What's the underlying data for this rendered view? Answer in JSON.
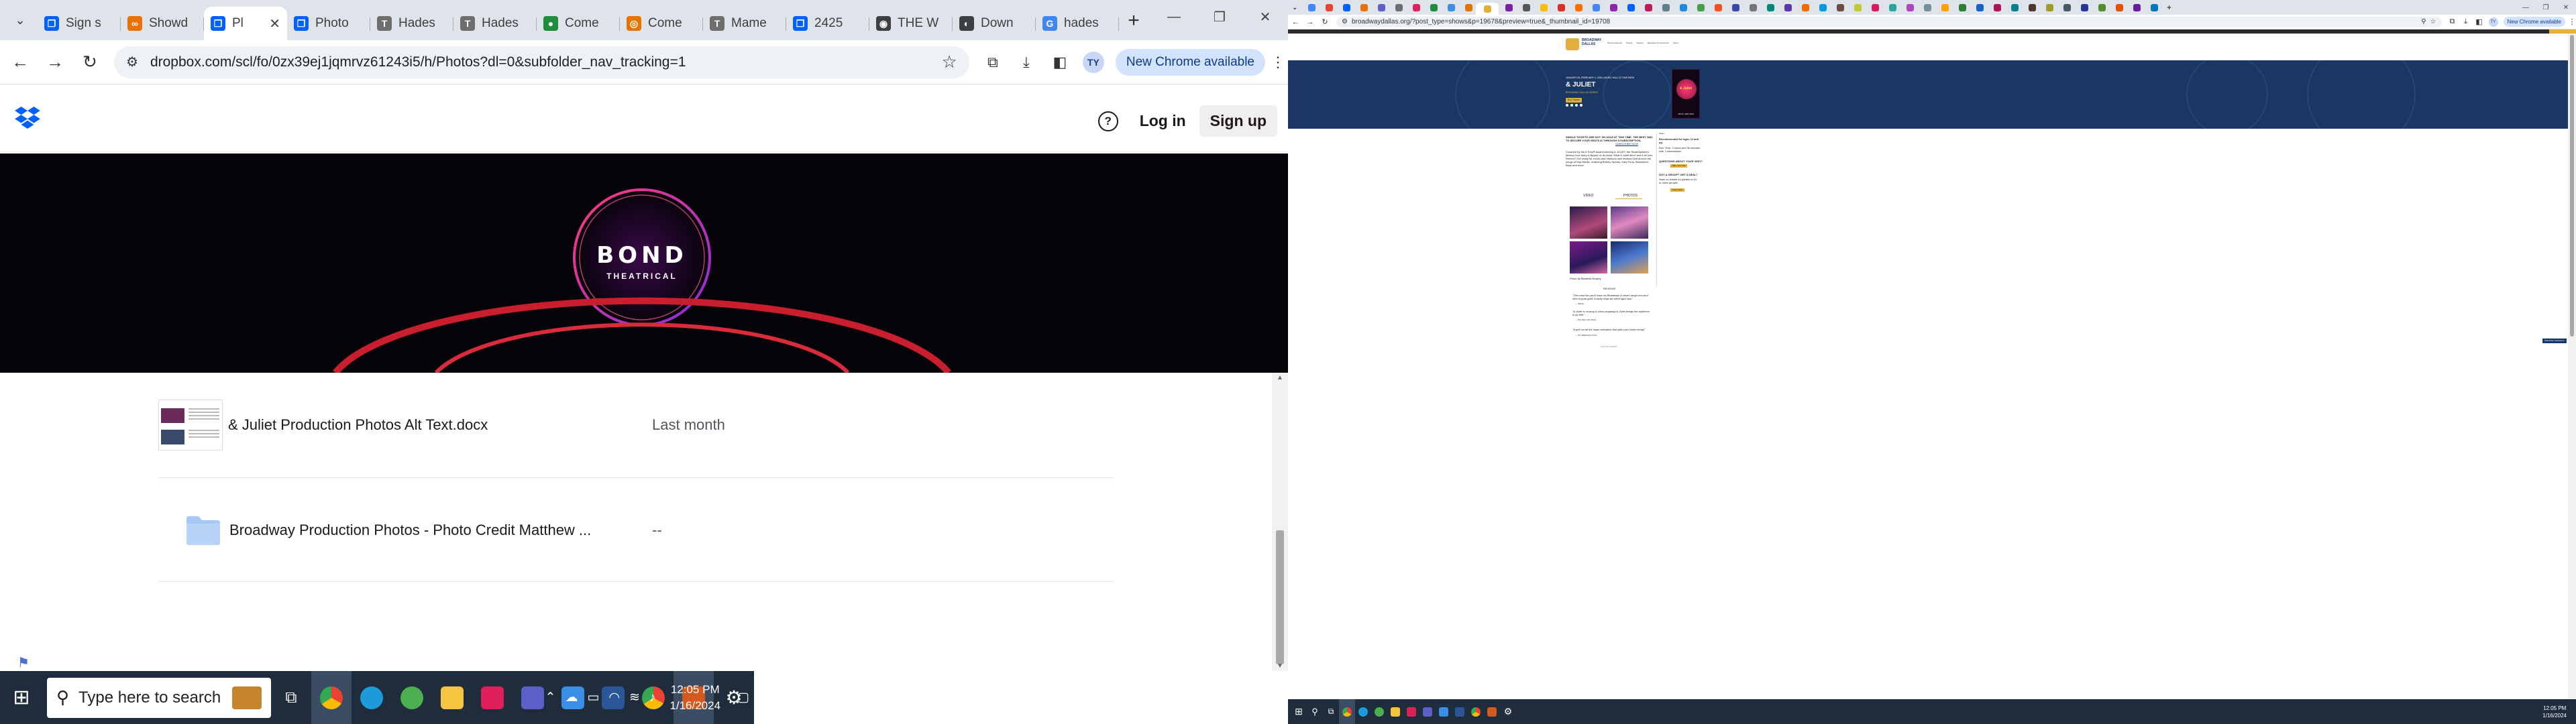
{
  "left_window": {
    "tabs": [
      {
        "title": "Sign s",
        "color": "#0061fe",
        "glyph": "❐"
      },
      {
        "title": "Showd",
        "color": "#e8710a",
        "glyph": "∞"
      },
      {
        "title": "Pl",
        "color": "#0061fe",
        "glyph": "❐",
        "active": true
      },
      {
        "title": "Photo",
        "color": "#0061fe",
        "glyph": "❐"
      },
      {
        "title": "Hades",
        "color": "#6e6e6e",
        "glyph": "T"
      },
      {
        "title": "Hades",
        "color": "#6e6e6e",
        "glyph": "T"
      },
      {
        "title": "Come",
        "color": "#1e8e3e",
        "glyph": "●"
      },
      {
        "title": "Come",
        "color": "#e37400",
        "glyph": "◎"
      },
      {
        "title": "Mame",
        "color": "#6e6e6e",
        "glyph": "T"
      },
      {
        "title": "2425",
        "color": "#0061fe",
        "glyph": "❐"
      },
      {
        "title": "THE W",
        "color": "#3c4043",
        "glyph": "◉"
      },
      {
        "title": "Down",
        "color": "#3c4043",
        "glyph": "◐"
      },
      {
        "title": "hades",
        "color": "#4285f4",
        "glyph": "G"
      }
    ],
    "url": "dropbox.com/scl/fo/0zx39ej1jqmrvz61243i5/h/Photos?dl=0&subfolder_nav_tracking=1",
    "profile_initials": "TY",
    "new_chrome_label": "New Chrome available",
    "header": {
      "login_label": "Log in",
      "signup_label": "Sign up",
      "help_glyph": "?"
    },
    "hero": {
      "brand": "BOND",
      "tagline": "THEATRICAL"
    },
    "files": [
      {
        "name": "& Juliet Production Photos Alt Text.docx",
        "modified": "Last month"
      },
      {
        "name": "Broadway Production Photos - Photo Credit Matthew ...",
        "modified": "--"
      }
    ],
    "colors": {
      "dropbox_blue": "#0061fe",
      "folder_blue": "#a8c8f5"
    }
  },
  "left_taskbar": {
    "search_placeholder": "Type here to search",
    "time": "12:05 PM",
    "date": "1/16/2024"
  },
  "right_window": {
    "url": "broadwaydallas.org/?post_type=shows&p=19678&preview=true&_thumbnail_id=19708",
    "profile_initials": "TY",
    "new_chrome_label": "New Chrome available",
    "nav": {
      "logo_top": "BROADWAY",
      "logo_bottom": "DALLAS",
      "links": [
        "Shows & Events",
        "Tickets",
        "Support",
        "Education & Community",
        "About"
      ]
    },
    "hero": {
      "dates": "JANUARY 30–FEBRUARY 4, 2024 | MUSIC HALL AT FAIR PARK",
      "title": "& JULIET",
      "subtitle": "BROADWAY DALLAS SERIES",
      "buy_label": "Buy Tickets",
      "poster_title": "& Juliet",
      "poster_footer": "JAN 30 - FEB 4 2024"
    },
    "intro": "SINGLE TICKETS ARE NOT ON SALE AT THIS TIME. THE BEST WAY TO SECURE YOUR SEATS IS THROUGH A SUBSCRIPTION.",
    "subscribe_link": "SUBSCRIBE NOW",
    "body": "Crowned by the 8 Tony® Award-winning & JULIET, the Shakespeare's famous love story is flipped on its head. What if Juliet didn't end it all over Romeo? Get ready for a bold and hilarious new musical built around the songs of Max Martin, featuring Britney Spears, Katy Perry, Backstreet Boys and more.",
    "media_tabs": [
      "VIDEO",
      "PHOTOS"
    ],
    "photo_credit": "Photo by Matthew Murphy",
    "reviews_heading": "REVIEWS",
    "reviews": [
      {
        "quote": "\"The most fun you'll have on Broadway! A smart, laugh-out-loud shot of pure gold. Exactly what we need right now.\"",
        "source": "— Variety"
      },
      {
        "quote": "\"& Juliet is rousing & show-stopping! & Juliet brings the audience to its feet.\"",
        "source": "— The New York Times"
      },
      {
        "quote": "\"A pull out all the stops sensation that gets your heart racing!\"",
        "source": "— The Washington Post"
      }
    ],
    "our_sponsors": "OUR SPONSORS",
    "sidebar": {
      "share": "Share",
      "recommended": "Recommended for ages 12 and up.",
      "runtime": "Run Time: 2 hours and 30 minutes with 1 intermission",
      "questions": "QUESTIONS ABOUT YOUR VISIT?",
      "visit_btn": "Plan Your Visit",
      "group": "GOT A GROUP? GET A DEAL!",
      "group_text": "Save on tickets for parties of 10 or more people!",
      "group_btn": "Learn More"
    },
    "chat_btn": "Subscriber Assistance",
    "colors": {
      "hero_blue": "#1a3764",
      "gold": "#e3b03a"
    }
  },
  "right_taskbar": {
    "time": "12:05 PM",
    "date": "1/16/2024"
  }
}
